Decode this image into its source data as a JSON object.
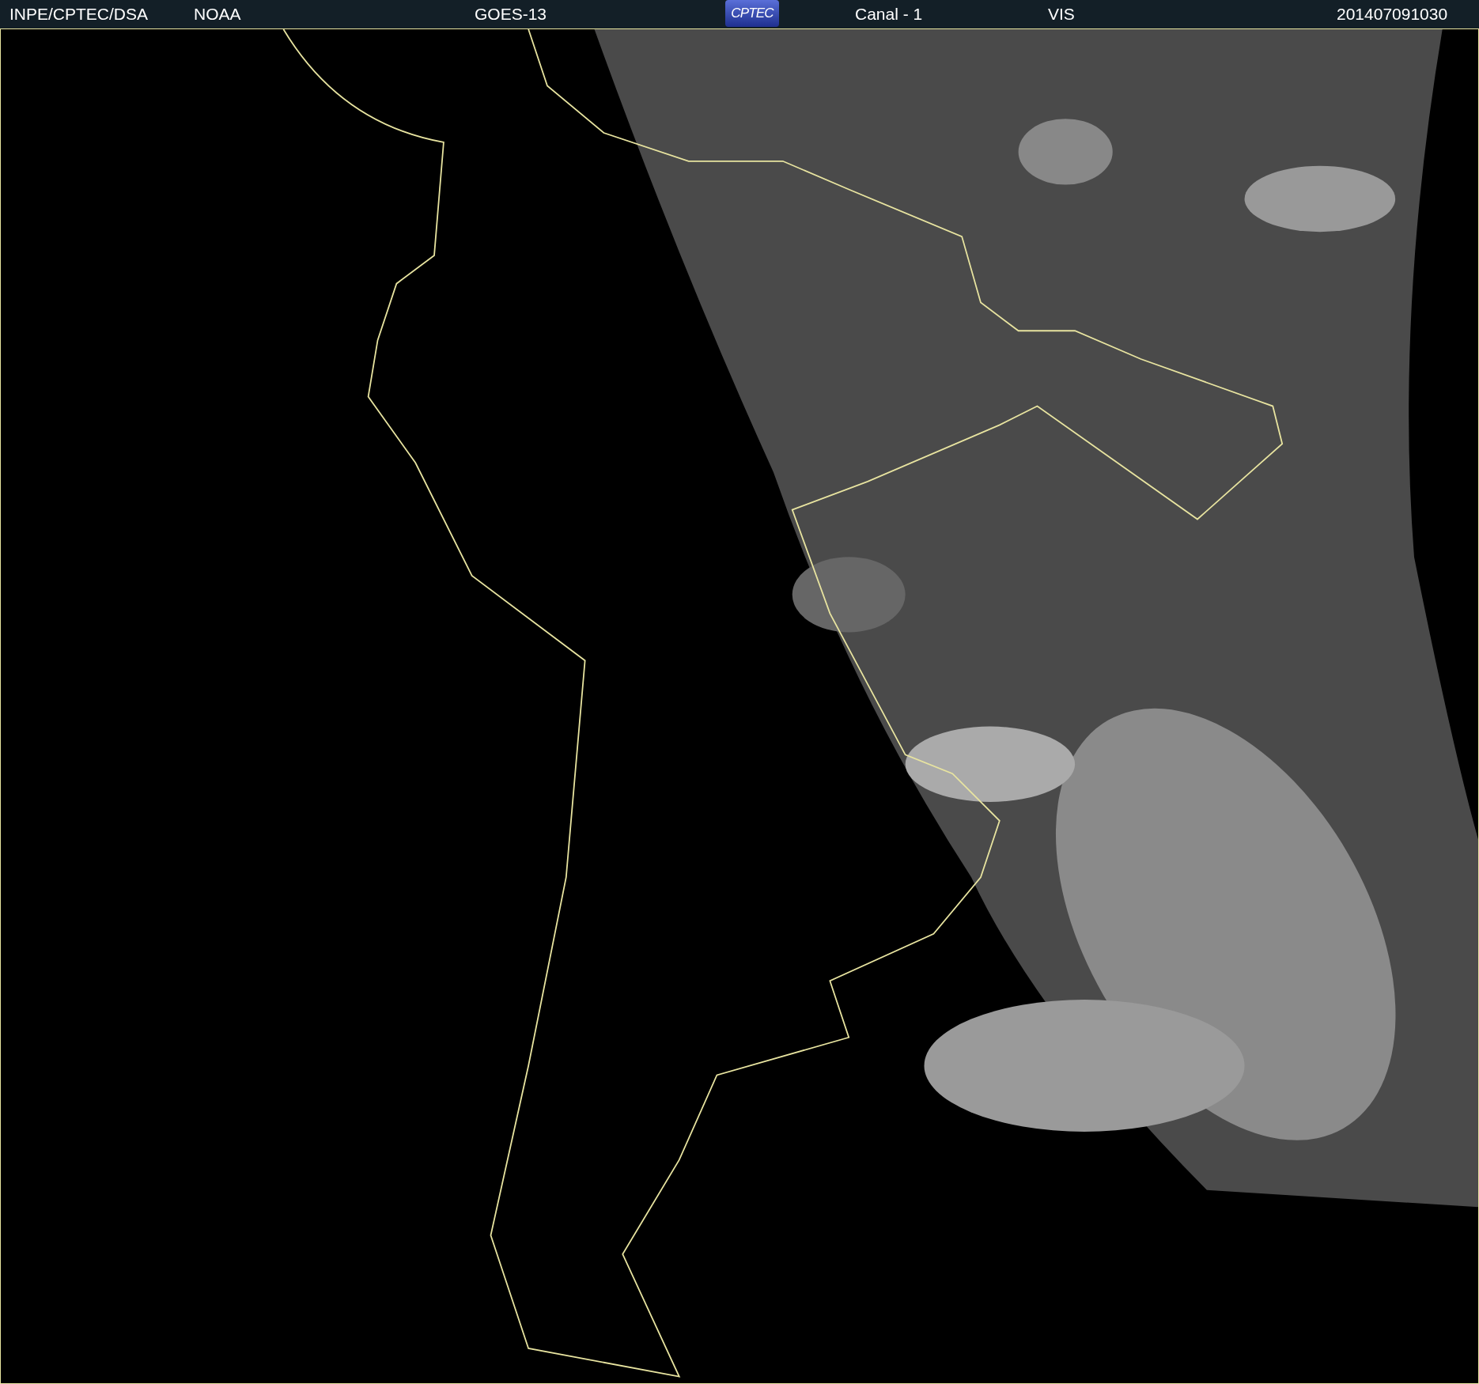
{
  "header": {
    "items": [
      {
        "kind": "text",
        "text": "INPE/CPTEC/DSA"
      },
      {
        "kind": "text",
        "text": "NOAA"
      },
      {
        "kind": "text",
        "text": "GOES-13"
      },
      {
        "kind": "logo",
        "text": "CPTEC"
      },
      {
        "kind": "text",
        "text": "Canal - 1"
      },
      {
        "kind": "text",
        "text": "VIS"
      },
      {
        "kind": "text",
        "text": "201407091030"
      }
    ]
  }
}
